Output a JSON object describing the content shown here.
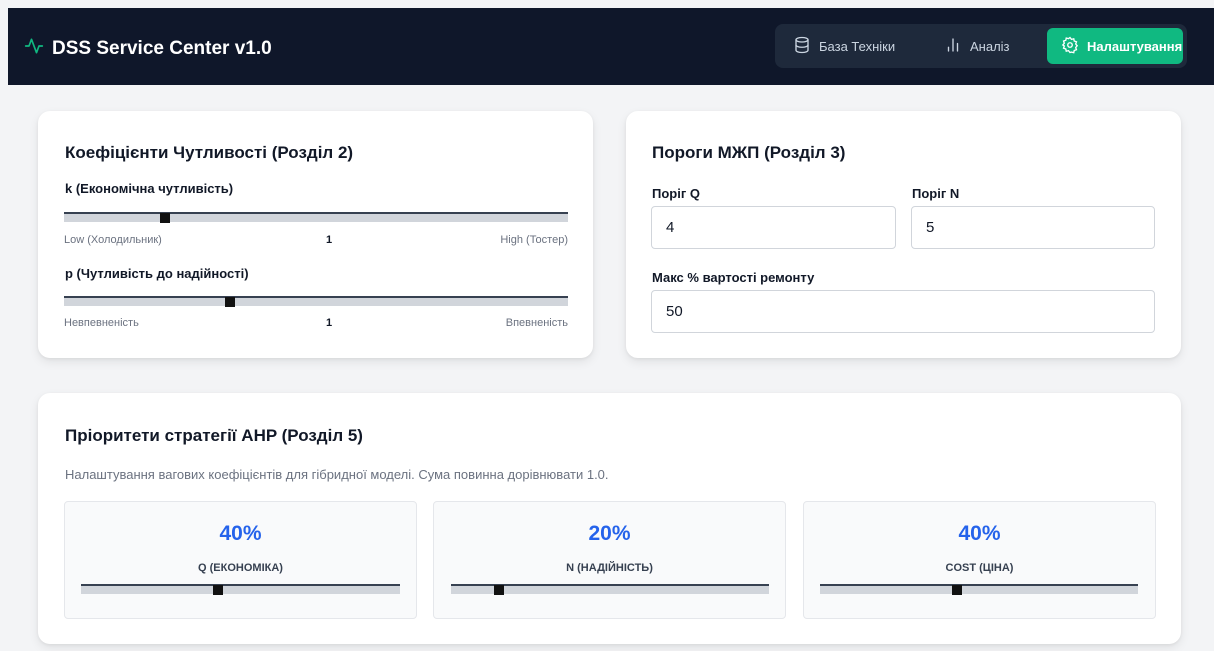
{
  "app": {
    "title": "DSS Service Center v1.0"
  },
  "nav": {
    "items": [
      {
        "label": "База Техніки",
        "icon": "database-icon",
        "active": false
      },
      {
        "label": "Аналіз",
        "icon": "bar-chart-icon",
        "active": false
      },
      {
        "label": "Налаштування",
        "icon": "gear-icon",
        "active": true
      }
    ]
  },
  "colors": {
    "accent": "#10b981",
    "header_bg": "#0f172a",
    "percent": "#2563eb"
  },
  "sensitivity": {
    "title": "Коефіцієнти Чутливості (Розділ 2)",
    "k": {
      "label": "k (Економічна чутливість)",
      "min_label": "Low (Холодильник)",
      "value": "1",
      "max_label": "High (Тостер)",
      "position": 0.2
    },
    "p": {
      "label": "p (Чутливість до надійності)",
      "min_label": "Невпевненість",
      "value": "1",
      "max_label": "Впевненість",
      "position": 0.33
    }
  },
  "thresholds": {
    "title": "Пороги МЖП (Розділ 3)",
    "q": {
      "label": "Поріг Q",
      "value": "4"
    },
    "n": {
      "label": "Поріг N",
      "value": "5"
    },
    "max_repair": {
      "label": "Макс % вартості ремонту",
      "value": "50"
    }
  },
  "ahp": {
    "title": "Пріоритети стратегії AHP (Розділ 5)",
    "description": "Налаштування вагових коефіцієнтів для гібридної моделі. Сума повинна дорівнювати 1.0.",
    "weights": [
      {
        "percent": "40%",
        "label": "Q (ЕКОНОМІКА)",
        "position": 0.43
      },
      {
        "percent": "20%",
        "label": "N (НАДІЙНІСТЬ)",
        "position": 0.15
      },
      {
        "percent": "40%",
        "label": "COST (ЦІНА)",
        "position": 0.43
      }
    ]
  }
}
